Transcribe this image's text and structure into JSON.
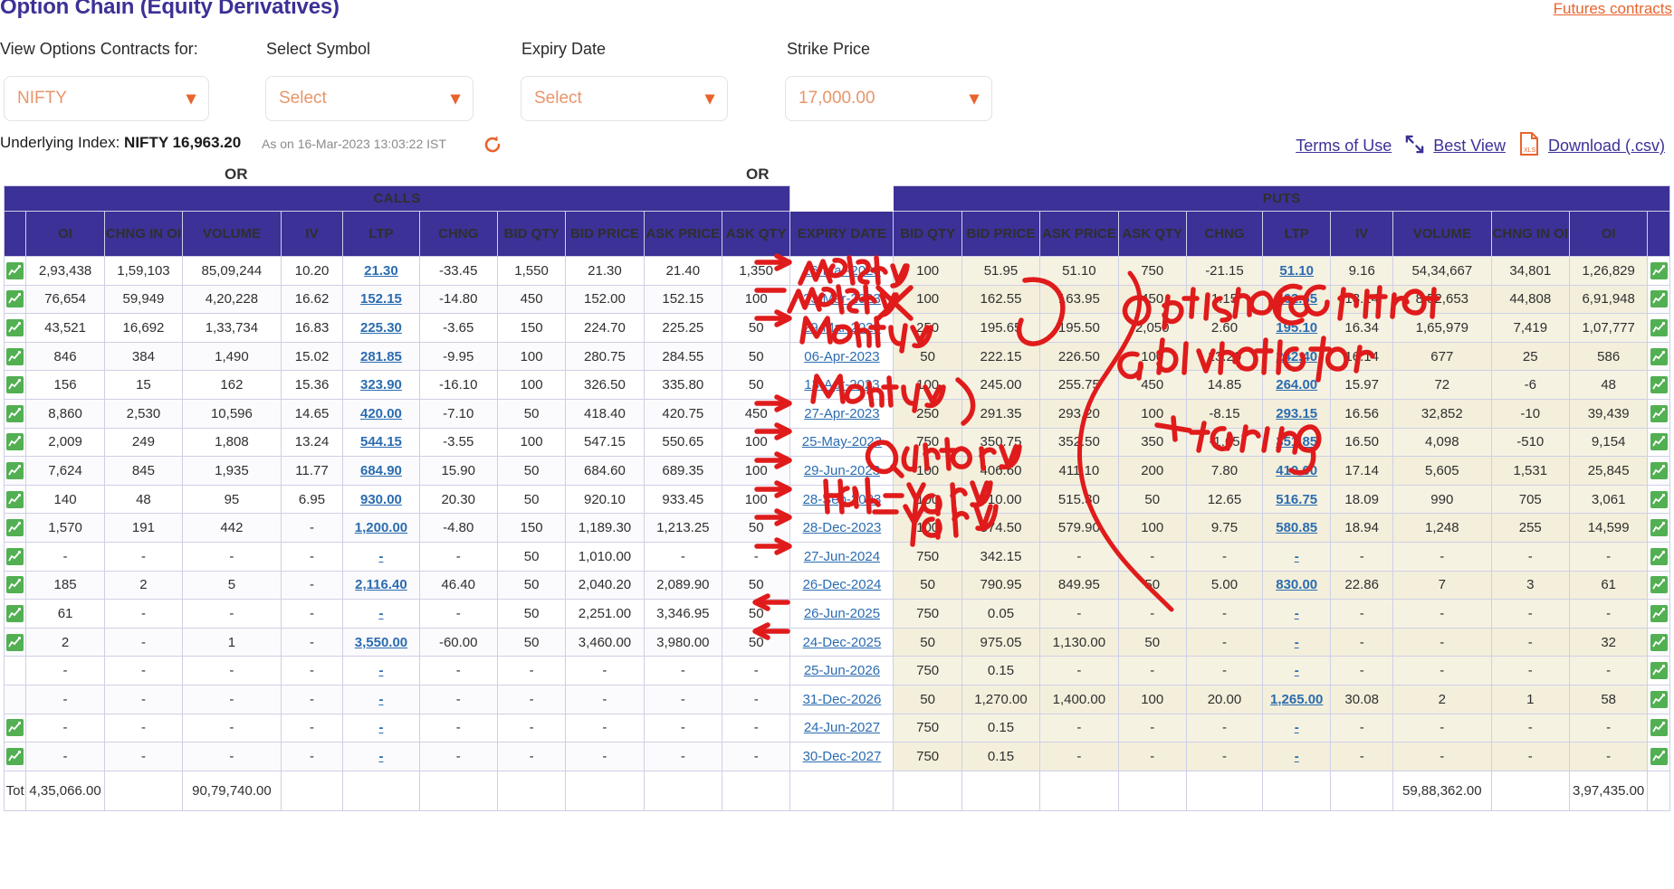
{
  "header": {
    "title": "Option Chain (Equity Derivatives)",
    "futures_link": "Futures contracts",
    "labels": {
      "view_for": "View Options Contracts for:",
      "select_symbol": "Select Symbol",
      "expiry_date": "Expiry Date",
      "strike_price": "Strike Price"
    },
    "or_1": "OR",
    "or_2": "OR",
    "selects": {
      "index_value": "NIFTY",
      "symbol_value": "Select",
      "expiry_value": "Select",
      "strike_value": "17,000.00",
      "chevron": "chevron-down"
    },
    "underlying_label": "Underlying Index:",
    "underlying_value": "NIFTY 16,963.20",
    "as_on": "As on 16-Mar-2023 13:03:22 IST",
    "terms_of_use": "Terms of Use",
    "best_view": "Best View",
    "download": "Download (.csv)"
  },
  "table": {
    "groups": {
      "calls": "CALLS",
      "puts": "PUTS"
    },
    "columns": {
      "calls": [
        "OI",
        "CHNG IN OI",
        "VOLUME",
        "IV",
        "LTP",
        "CHNG",
        "BID QTY",
        "BID PRICE",
        "ASK PRICE",
        "ASK QTY"
      ],
      "expiry": "EXPIRY DATE",
      "puts": [
        "BID QTY",
        "BID PRICE",
        "ASK PRICE",
        "ASK QTY",
        "CHNG",
        "LTP",
        "IV",
        "VOLUME",
        "CHNG IN OI",
        "OI"
      ]
    },
    "rows": [
      {
        "c": [
          "2,93,438",
          "1,59,103",
          "85,09,244",
          "10.20",
          "21.30",
          "-33.45",
          "1,550",
          "21.30",
          "21.40",
          "1,350"
        ],
        "e": "16-Mar-2023",
        "p": [
          "100",
          "51.95",
          "51.10",
          "750",
          "-21.15",
          "51.10",
          "9.16",
          "54,34,667",
          "34,801",
          "1,26,829"
        ],
        "cchg": "down",
        "pchg": "down",
        "cico": true,
        "pico": true
      },
      {
        "c": [
          "76,654",
          "59,949",
          "4,20,228",
          "16.62",
          "152.15",
          "-14.80",
          "450",
          "152.00",
          "152.15",
          "100"
        ],
        "e": "23-Mar-2023",
        "p": [
          "100",
          "162.55",
          "163.95",
          "450",
          "1.15",
          "162.65",
          "13.24",
          "8,52,653",
          "44,808",
          "6,91,948"
        ],
        "cchg": "down",
        "pchg": "up",
        "cico": true,
        "pico": true
      },
      {
        "c": [
          "43,521",
          "16,692",
          "1,33,734",
          "16.83",
          "225.30",
          "-3.65",
          "150",
          "224.70",
          "225.25",
          "50"
        ],
        "e": "29-Mar-2023",
        "p": [
          "250",
          "195.65",
          "195.50",
          "2,050",
          "2.60",
          "195.10",
          "16.34",
          "1,65,979",
          "7,419",
          "1,07,777"
        ],
        "cchg": "down",
        "pchg": "up",
        "cico": true,
        "pico": true
      },
      {
        "c": [
          "846",
          "384",
          "1,490",
          "15.02",
          "281.85",
          "-9.95",
          "100",
          "280.75",
          "284.55",
          "50"
        ],
        "e": "06-Apr-2023",
        "p": [
          "50",
          "222.15",
          "226.50",
          "100",
          "13.20",
          "242.40",
          "16.14",
          "677",
          "25",
          "586"
        ],
        "cchg": "down",
        "pchg": "up",
        "cico": true,
        "pico": true
      },
      {
        "c": [
          "156",
          "15",
          "162",
          "15.36",
          "323.90",
          "-16.10",
          "100",
          "326.50",
          "335.80",
          "50"
        ],
        "e": "13-Apr-2023",
        "p": [
          "100",
          "245.00",
          "255.75",
          "450",
          "14.85",
          "264.00",
          "15.97",
          "72",
          "-6",
          "48"
        ],
        "cchg": "down",
        "pchg": "up",
        "cico": true,
        "pico": true
      },
      {
        "c": [
          "8,860",
          "2,530",
          "10,596",
          "14.65",
          "420.00",
          "-7.10",
          "50",
          "418.40",
          "420.75",
          "450"
        ],
        "e": "27-Apr-2023",
        "p": [
          "250",
          "291.35",
          "293.20",
          "100",
          "-8.15",
          "293.15",
          "16.56",
          "32,852",
          "-10",
          "39,439"
        ],
        "cchg": "down",
        "pchg": "down",
        "cico": true,
        "pico": true
      },
      {
        "c": [
          "2,009",
          "249",
          "1,808",
          "13.24",
          "544.15",
          "-3.55",
          "100",
          "547.15",
          "550.65",
          "100"
        ],
        "e": "25-May-2023",
        "p": [
          "750",
          "350.75",
          "352.50",
          "350",
          "-1.65",
          "351.85",
          "16.50",
          "4,098",
          "-510",
          "9,154"
        ],
        "cchg": "down",
        "pchg": "down",
        "cico": true,
        "pico": true
      },
      {
        "c": [
          "7,624",
          "845",
          "1,935",
          "11.77",
          "684.90",
          "15.90",
          "50",
          "684.60",
          "689.35",
          "100"
        ],
        "e": "29-Jun-2023",
        "p": [
          "100",
          "406.60",
          "411.10",
          "200",
          "7.80",
          "410.00",
          "17.14",
          "5,605",
          "1,531",
          "25,845"
        ],
        "cchg": "up",
        "pchg": "up",
        "cico": true,
        "pico": true
      },
      {
        "c": [
          "140",
          "48",
          "95",
          "6.95",
          "930.00",
          "20.30",
          "50",
          "920.10",
          "933.45",
          "100"
        ],
        "e": "28-Sep-2023",
        "p": [
          "100",
          "510.00",
          "515.30",
          "50",
          "12.65",
          "516.75",
          "18.09",
          "990",
          "705",
          "3,061"
        ],
        "cchg": "up",
        "pchg": "up",
        "cico": true,
        "pico": true
      },
      {
        "c": [
          "1,570",
          "191",
          "442",
          "-",
          "1,200.00",
          "-4.80",
          "150",
          "1,189.30",
          "1,213.25",
          "50"
        ],
        "e": "28-Dec-2023",
        "p": [
          "100",
          "574.50",
          "579.90",
          "100",
          "9.75",
          "580.85",
          "18.94",
          "1,248",
          "255",
          "14,599"
        ],
        "cchg": "down",
        "pchg": "up",
        "cico": true,
        "pico": true
      },
      {
        "c": [
          "-",
          "-",
          "-",
          "-",
          "-",
          "-",
          "50",
          "1,010.00",
          "-",
          "-"
        ],
        "e": "27-Jun-2024",
        "p": [
          "750",
          "342.15",
          "-",
          "-",
          "-",
          "-",
          "-",
          "-",
          "-",
          "-"
        ],
        "cchg": "",
        "pchg": "",
        "cico": true,
        "pico": true
      },
      {
        "c": [
          "185",
          "2",
          "5",
          "-",
          "2,116.40",
          "46.40",
          "50",
          "2,040.20",
          "2,089.90",
          "50"
        ],
        "e": "26-Dec-2024",
        "p": [
          "50",
          "790.95",
          "849.95",
          "50",
          "5.00",
          "830.00",
          "22.86",
          "7",
          "3",
          "61"
        ],
        "cchg": "up",
        "pchg": "up",
        "cico": true,
        "pico": true
      },
      {
        "c": [
          "61",
          "-",
          "-",
          "-",
          "-",
          "-",
          "50",
          "2,251.00",
          "3,346.95",
          "50"
        ],
        "e": "26-Jun-2025",
        "p": [
          "750",
          "0.05",
          "-",
          "-",
          "-",
          "-",
          "-",
          "-",
          "-",
          "-"
        ],
        "cchg": "",
        "pchg": "",
        "cico": true,
        "pico": true
      },
      {
        "c": [
          "2",
          "-",
          "1",
          "-",
          "3,550.00",
          "-60.00",
          "50",
          "3,460.00",
          "3,980.00",
          "50"
        ],
        "e": "24-Dec-2025",
        "p": [
          "50",
          "975.05",
          "1,130.00",
          "50",
          "-",
          "-",
          "-",
          "-",
          "-",
          "32"
        ],
        "cchg": "down",
        "pchg": "",
        "cico": true,
        "pico": true
      },
      {
        "c": [
          "-",
          "-",
          "-",
          "-",
          "-",
          "-",
          "-",
          "-",
          "-",
          "-"
        ],
        "e": "25-Jun-2026",
        "p": [
          "750",
          "0.15",
          "-",
          "-",
          "-",
          "-",
          "-",
          "-",
          "-",
          "-"
        ],
        "cchg": "",
        "pchg": "",
        "cico": false,
        "pico": true
      },
      {
        "c": [
          "-",
          "-",
          "-",
          "-",
          "-",
          "-",
          "-",
          "-",
          "-",
          "-"
        ],
        "e": "31-Dec-2026",
        "p": [
          "50",
          "1,270.00",
          "1,400.00",
          "100",
          "20.00",
          "1,265.00",
          "30.08",
          "2",
          "1",
          "58"
        ],
        "cchg": "",
        "pchg": "up",
        "cico": false,
        "pico": true
      },
      {
        "c": [
          "-",
          "-",
          "-",
          "-",
          "-",
          "-",
          "-",
          "-",
          "-",
          "-"
        ],
        "e": "24-Jun-2027",
        "p": [
          "750",
          "0.15",
          "-",
          "-",
          "-",
          "-",
          "-",
          "-",
          "-",
          "-"
        ],
        "cchg": "",
        "pchg": "",
        "cico": true,
        "pico": true
      },
      {
        "c": [
          "-",
          "-",
          "-",
          "-",
          "-",
          "-",
          "-",
          "-",
          "-",
          "-"
        ],
        "e": "30-Dec-2027",
        "p": [
          "750",
          "0.15",
          "-",
          "-",
          "-",
          "-",
          "-",
          "-",
          "-",
          "-"
        ],
        "cchg": "",
        "pchg": "",
        "cico": true,
        "pico": true
      }
    ],
    "total": {
      "label": "Tot",
      "calls_oi": "4,35,066.00",
      "calls_volume": "90,79,740.00",
      "puts_volume": "59,88,362.00",
      "puts_chng_oi": "3,97,435.00"
    }
  },
  "annotations": {
    "weekly": "Weekly",
    "monthly_1": "Monthly",
    "monthly_2": "Monthly",
    "quarterly": "Quarterly",
    "half_yearly": "Half-yearly",
    "yearly": "Yearly",
    "note": "Options Contract available for trading"
  },
  "colors": {
    "brand_purple": "#3b3196",
    "accent_orange": "#e8642d",
    "link_blue": "#2b6cb0",
    "up_green": "#1a8a3c",
    "down_red": "#e02020",
    "puts_bg": "#f6f2e2",
    "ink_red": "#e01b1b"
  }
}
